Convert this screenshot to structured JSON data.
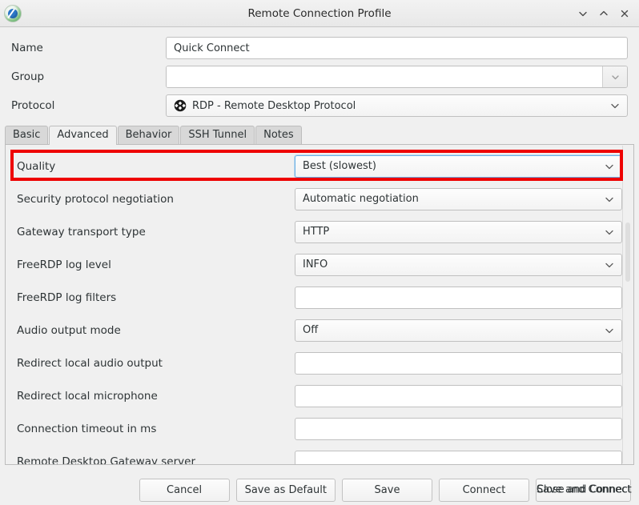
{
  "window": {
    "title": "Remote Connection Profile",
    "icon": "remmina-app-icon",
    "controls": [
      {
        "name": "minimize-button",
        "glyph": "chevron-down"
      },
      {
        "name": "maximize-button",
        "glyph": "chevron-up"
      },
      {
        "name": "close-button",
        "glyph": "x"
      }
    ]
  },
  "topform": {
    "name": {
      "label": "Name",
      "value": "Quick Connect"
    },
    "group": {
      "label": "Group",
      "value": "",
      "placeholder": ""
    },
    "protocol": {
      "label": "Protocol",
      "value": "RDP - Remote Desktop Protocol",
      "icon": "rdp-protocol-icon"
    }
  },
  "tabs": [
    {
      "label": "Basic",
      "active": false
    },
    {
      "label": "Advanced",
      "active": true
    },
    {
      "label": "Behavior",
      "active": false
    },
    {
      "label": "SSH Tunnel",
      "active": false
    },
    {
      "label": "Notes",
      "active": false
    }
  ],
  "advanced_rows": [
    {
      "label": "Quality",
      "type": "combo",
      "value": "Best (slowest)",
      "focused": true,
      "highlighted": true
    },
    {
      "label": "Security protocol negotiation",
      "type": "combo",
      "value": "Automatic negotiation"
    },
    {
      "label": "Gateway transport type",
      "type": "combo",
      "value": "HTTP"
    },
    {
      "label": "FreeRDP log level",
      "type": "combo",
      "value": "INFO"
    },
    {
      "label": "FreeRDP log filters",
      "type": "text",
      "value": ""
    },
    {
      "label": "Audio output mode",
      "type": "combo",
      "value": "Off"
    },
    {
      "label": "Redirect local audio output",
      "type": "text",
      "value": ""
    },
    {
      "label": "Redirect local microphone",
      "type": "text",
      "value": ""
    },
    {
      "label": "Connection timeout in ms",
      "type": "text",
      "value": ""
    },
    {
      "label": "Remote Desktop Gateway server",
      "type": "text",
      "value": ""
    }
  ],
  "buttons": [
    {
      "name": "cancel-button",
      "label": "Cancel"
    },
    {
      "name": "save-as-default-button",
      "label": "Save as Default"
    },
    {
      "name": "save-button",
      "label": "Save"
    },
    {
      "name": "connect-button",
      "label": "Connect"
    },
    {
      "name": "save-and-connect-button",
      "label": "Save and Connect",
      "overlay_label": "Close and Connect"
    }
  ],
  "colors": {
    "highlight": "#ee0000",
    "focus": "#6ab0e6",
    "window_bg": "#f0f0f0",
    "text": "#2e3436"
  }
}
